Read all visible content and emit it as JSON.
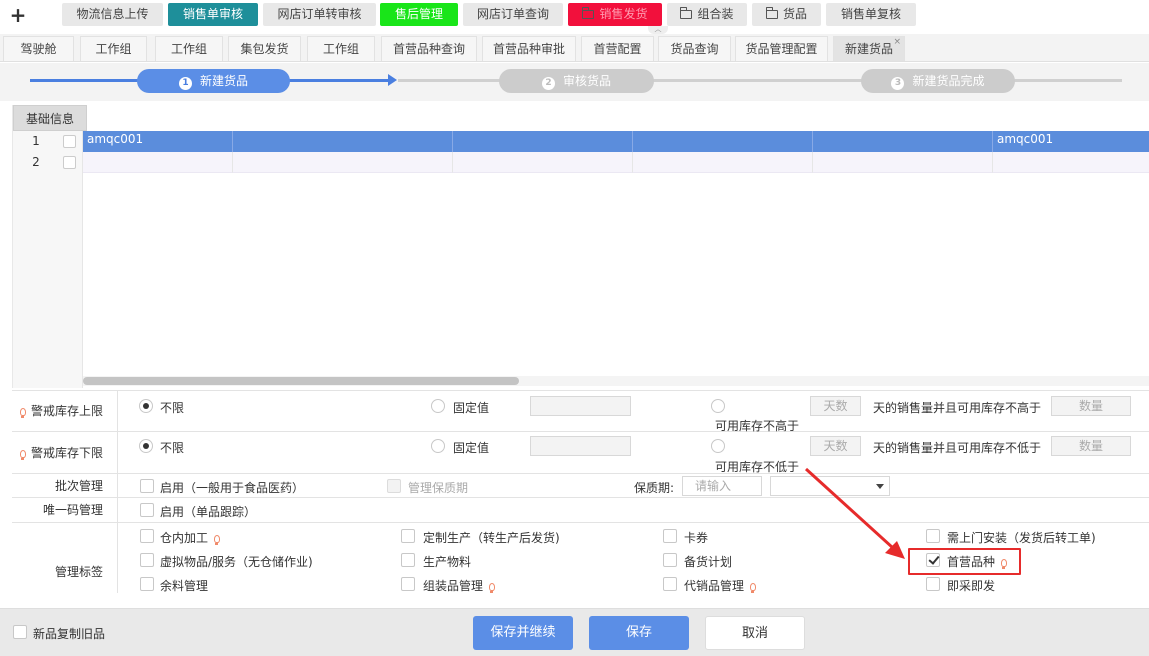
{
  "topmenu": {
    "add_icon": "plus-icon",
    "items": [
      {
        "label": "物流信息上传",
        "bg": "#e8e8e8",
        "fg": "#444444"
      },
      {
        "label": "销售单审核",
        "bg": "#1e8f9a",
        "fg": "#ffffff"
      },
      {
        "label": "网店订单转审核",
        "bg": "#e8e8e8",
        "fg": "#444444"
      },
      {
        "label": "售后管理",
        "bg": "#19e519",
        "fg": "#ffffff"
      },
      {
        "label": "网店订单查询",
        "bg": "#e8e8e8",
        "fg": "#444444"
      },
      {
        "label": "销售发货",
        "bg": "#f2103c",
        "fg": "#ff9bb0",
        "icon": "folder-icon"
      },
      {
        "label": "组合装",
        "bg": "#e8e8e8",
        "fg": "#444444",
        "icon": "folder-icon"
      },
      {
        "label": "货品",
        "bg": "#e8e8e8",
        "fg": "#444444",
        "icon": "folder-icon"
      },
      {
        "label": "销售单复核",
        "bg": "#e8e8e8",
        "fg": "#444444"
      }
    ],
    "collapse_glyph": "︿"
  },
  "tabs": [
    {
      "label": "驾驶舱"
    },
    {
      "label": "工作组"
    },
    {
      "label": "工作组"
    },
    {
      "label": "集包发货"
    },
    {
      "label": "工作组"
    },
    {
      "label": "首营品种查询"
    },
    {
      "label": "首营品种审批"
    },
    {
      "label": "首营配置"
    },
    {
      "label": "货品查询"
    },
    {
      "label": "货品管理配置"
    },
    {
      "label": "新建货品",
      "active": true,
      "close": "×"
    }
  ],
  "steps": [
    {
      "num": "1",
      "label": "新建货品",
      "state": "active",
      "color": "#5b8ee6"
    },
    {
      "num": "2",
      "label": "审核货品",
      "state": "pending",
      "color": "#cccccc"
    },
    {
      "num": "3",
      "label": "新建货品完成",
      "state": "pending",
      "color": "#cccccc"
    }
  ],
  "grid": {
    "tab_label": "基础信息",
    "rows": [
      {
        "num": "1",
        "cells": [
          "amqc001",
          "",
          "",
          "",
          "",
          "amqc001"
        ],
        "selected": true
      },
      {
        "num": "2",
        "cells": [
          "",
          "",
          "",
          "",
          "",
          ""
        ],
        "selected": false
      }
    ]
  },
  "form": {
    "upper": {
      "label": "警戒库存上限",
      "opt_unlimited": "不限",
      "opt_fixed": "固定值",
      "opt_available": "可用库存不高于",
      "days_placeholder": "天数",
      "mid_text": "天的销售量并且可用库存不高于",
      "qty_placeholder": "数量"
    },
    "lower": {
      "label": "警戒库存下限",
      "opt_unlimited": "不限",
      "opt_fixed": "固定值",
      "opt_available": "可用库存不低于",
      "days_placeholder": "天数",
      "mid_text": "天的销售量并且可用库存不低于",
      "qty_placeholder": "数量"
    },
    "batch": {
      "label": "批次管理",
      "enable": "启用（一般用于食品医药）",
      "shelf_manage": "管理保质期",
      "shelf_label": "保质期:",
      "shelf_placeholder": "请输入"
    },
    "unique": {
      "label": "唯一码管理",
      "enable": "启用（单品跟踪）"
    },
    "tags": {
      "label": "管理标签",
      "items": [
        {
          "label": "仓内加工",
          "checked": false,
          "bulb": true
        },
        {
          "label": "定制生产（转生产后发货)",
          "checked": false
        },
        {
          "label": "卡券",
          "checked": false
        },
        {
          "label": "需上门安装（发货后转工单)",
          "checked": false
        },
        {
          "label": "虚拟物品/服务（无仓储作业)",
          "checked": false
        },
        {
          "label": "生产物料",
          "checked": false
        },
        {
          "label": "备货计划",
          "checked": false
        },
        {
          "label": "首营品种",
          "checked": true,
          "bulb": true
        },
        {
          "label": "余料管理",
          "checked": false
        },
        {
          "label": "组装品管理",
          "checked": false,
          "bulb": true
        },
        {
          "label": "代销品管理",
          "checked": false,
          "bulb": true
        },
        {
          "label": "即采即发",
          "checked": false
        }
      ]
    }
  },
  "footer": {
    "copy_old": "新品复制旧品",
    "save_continue": "保存并继续",
    "save": "保存",
    "cancel": "取消"
  }
}
